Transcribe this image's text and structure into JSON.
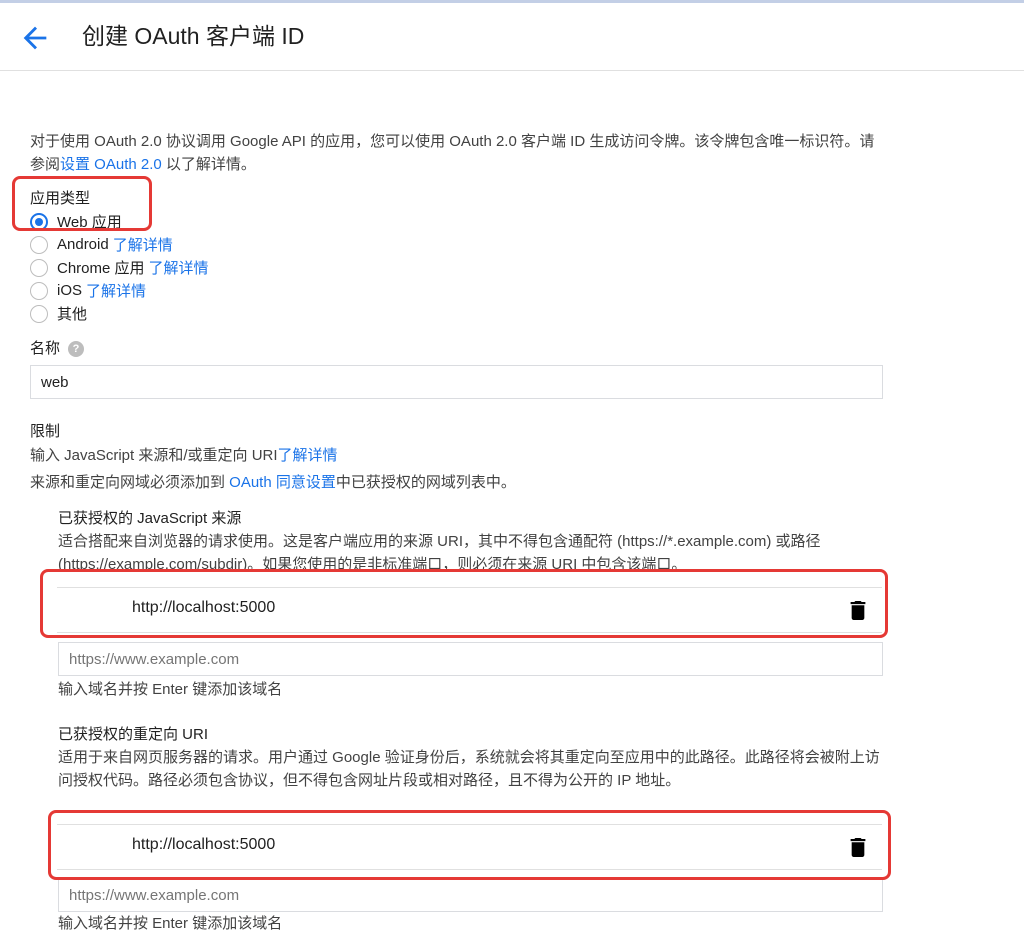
{
  "header": {
    "title": "创建 OAuth 客户端 ID"
  },
  "intro": {
    "text_before": "对于使用 OAuth 2.0 协议调用 Google API 的应用，您可以使用 OAuth 2.0 客户端 ID 生成访问令牌。该令牌包含唯一标识符。请参阅",
    "link": "设置 OAuth 2.0",
    "text_after": " 以了解详情。"
  },
  "app_type": {
    "label": "应用类型",
    "options": [
      {
        "label": "Web 应用",
        "link": "",
        "checked": true
      },
      {
        "label": "Android",
        "link": "了解详情",
        "checked": false
      },
      {
        "label": "Chrome 应用",
        "link": "了解详情",
        "checked": false
      },
      {
        "label": "iOS",
        "link": "了解详情",
        "checked": false
      },
      {
        "label": "其他",
        "link": "",
        "checked": false
      }
    ]
  },
  "name": {
    "label": "名称",
    "value": "web"
  },
  "restrictions": {
    "label": "限制",
    "desc_before": "输入 JavaScript 来源和/或重定向 URI",
    "desc_link": "了解详情",
    "note_before": "来源和重定向网域必须添加到 ",
    "note_link": "OAuth 同意设置",
    "note_after": "中已获授权的网域列表中。"
  },
  "js_origins": {
    "title": "已获授权的 JavaScript 来源",
    "desc": "适合搭配来自浏览器的请求使用。这是客户端应用的来源 URI，其中不得包含通配符 (https://*.example.com) 或路径 (https://example.com/subdir)。如果您使用的是非标准端口，则必须在来源 URI 中包含该端口。",
    "entry": "http://localhost:5000",
    "placeholder": "https://www.example.com",
    "hint": "输入域名并按 Enter 键添加该域名"
  },
  "redirect_uris": {
    "title": "已获授权的重定向 URI",
    "desc": "适用于来自网页服务器的请求。用户通过 Google 验证身份后，系统就会将其重定向至应用中的此路径。此路径将会被附上访问授权代码。路径必须包含协议，但不得包含网址片段或相对路径，且不得为公开的 IP 地址。",
    "entry": "http://localhost:5000",
    "placeholder": "https://www.example.com",
    "hint": "输入域名并按 Enter 键添加该域名"
  },
  "colors": {
    "accent": "#1a73e8",
    "highlight": "#e53935"
  },
  "icons": {
    "back": "arrow-back-icon",
    "help": "help-icon",
    "delete": "trash-icon"
  }
}
